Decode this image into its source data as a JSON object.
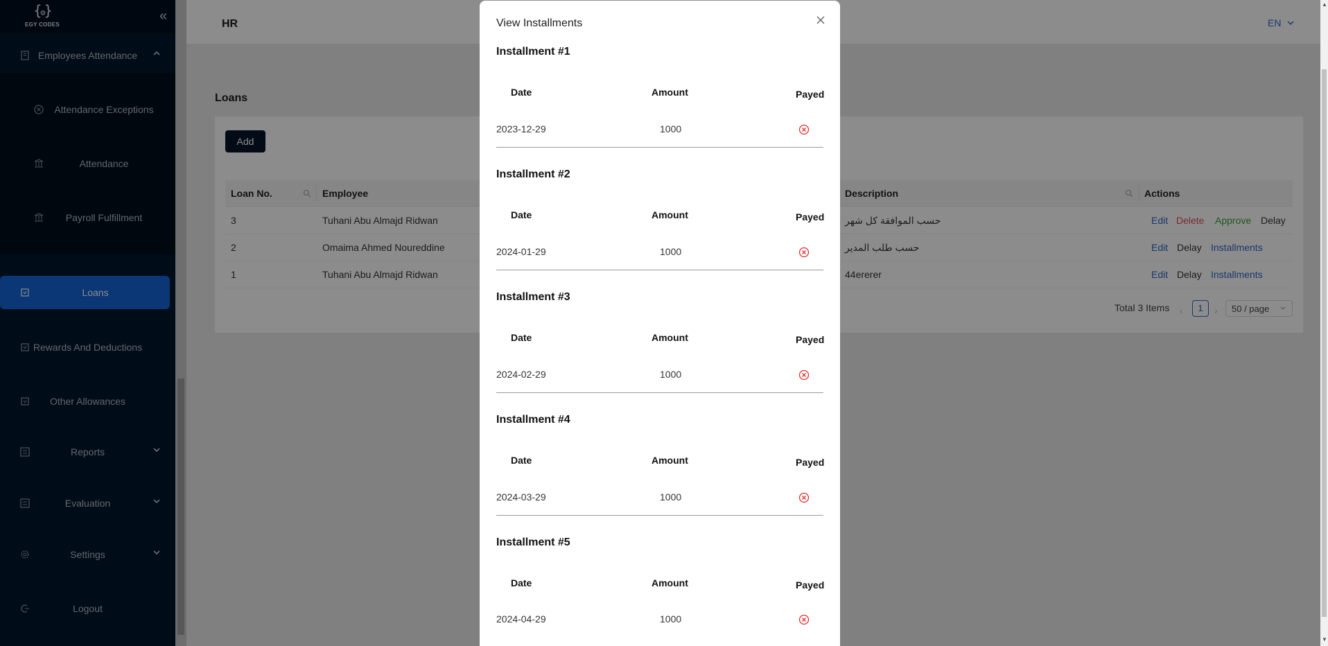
{
  "sidebar": {
    "logo_text": "EGY CODES",
    "items": [
      {
        "label": "Employees Attendance",
        "icon": "building-icon"
      },
      {
        "label": "Attendance Exceptions",
        "icon": "close-circle-icon"
      },
      {
        "label": "Attendance",
        "icon": "bank-icon"
      },
      {
        "label": "Payroll Fulfillment",
        "icon": "bank-icon"
      },
      {
        "label": "Loans",
        "icon": "calendar-icon"
      },
      {
        "label": "Rewards And Deductions",
        "icon": "calendar-icon"
      },
      {
        "label": "Other Allowances",
        "icon": "calendar-icon"
      },
      {
        "label": "Reports",
        "icon": "report-icon"
      },
      {
        "label": "Evaluation",
        "icon": "report-icon"
      },
      {
        "label": "Settings",
        "icon": "gear-icon"
      },
      {
        "label": "Logout",
        "icon": "logout-icon"
      }
    ]
  },
  "header": {
    "title": "HR",
    "lang": "EN"
  },
  "page": {
    "section_title": "Loans",
    "add_label": "Add"
  },
  "table": {
    "columns": [
      "Loan No.",
      "Employee",
      "Description",
      "Actions"
    ],
    "rows": [
      {
        "no": "3",
        "employee": "Tuhani Abu Almajd Ridwan",
        "description": "حسب الموافقة كل شهر",
        "actions": [
          "Edit",
          "Delete",
          "Approve",
          "Delay"
        ]
      },
      {
        "no": "2",
        "employee": "Omaima Ahmed Noureddine",
        "description": "حسب طلب المدير",
        "actions": [
          "Edit",
          "Delay",
          "Installments"
        ]
      },
      {
        "no": "1",
        "employee": "Tuhani Abu Almajd Ridwan",
        "description": "44ererer",
        "actions": [
          "Edit",
          "Delay",
          "Installments"
        ]
      }
    ]
  },
  "pagination": {
    "total": "Total 3 Items",
    "current": "1",
    "page_size": "50 / page"
  },
  "modal": {
    "title": "View Installments",
    "headers": {
      "date": "Date",
      "amount": "Amount",
      "payed": "Payed"
    },
    "installments": [
      {
        "title": "Installment #1",
        "date": "2023-12-29",
        "amount": "1000",
        "payed": false
      },
      {
        "title": "Installment #2",
        "date": "2024-01-29",
        "amount": "1000",
        "payed": false
      },
      {
        "title": "Installment #3",
        "date": "2024-02-29",
        "amount": "1000",
        "payed": false
      },
      {
        "title": "Installment #4",
        "date": "2024-03-29",
        "amount": "1000",
        "payed": false
      },
      {
        "title": "Installment #5",
        "date": "2024-04-29",
        "amount": "1000",
        "payed": false
      }
    ]
  },
  "colors": {
    "sidebar_bg": "#01162d",
    "active": "#1565d8",
    "link": "#2d67c6",
    "danger": "#e5485b",
    "success": "#38a13a",
    "unpaid": "#e03131"
  }
}
